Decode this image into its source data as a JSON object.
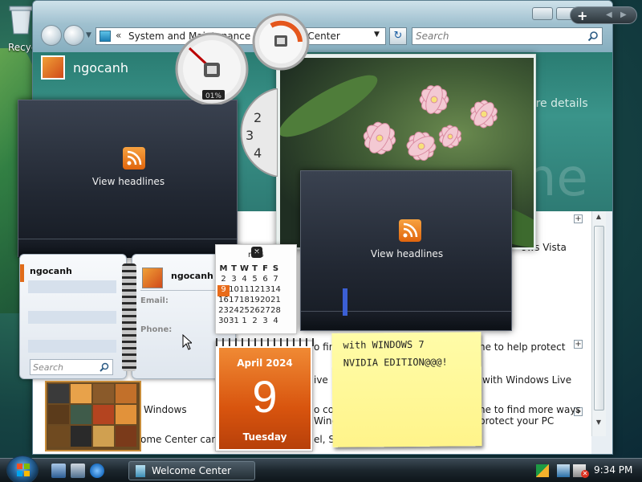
{
  "desktop": {
    "recycle_label": "Recycle"
  },
  "window": {
    "address": {
      "chevrons": "«",
      "path": "System and Maintenance › Welcome Center"
    },
    "search_placeholder": "Search",
    "user_name": "ngocanh",
    "more_details": "ore details",
    "big_text": "me",
    "content_lines": [
      "ows Vista",
      "ne to help protect",
      "with Windows Live",
      "ne to find more ways",
      "protect your PC",
      "Windows",
      "ome Center can b",
      "el, Sy",
      "o fin",
      "ive",
      "o co",
      "Wind"
    ]
  },
  "rss_gadget_1": {
    "label": "View headlines"
  },
  "rss_gadget_2": {
    "label": "View headlines"
  },
  "cpu_meter": {
    "cpu_percent": 1,
    "cpu_label": "01%"
  },
  "clock": {
    "numbers": [
      "2",
      "3",
      "4"
    ]
  },
  "contacts": {
    "list_name": "ngocanh",
    "search_placeholder": "Search",
    "detail_name": "ngocanh",
    "email_label": "Email:",
    "phone_label": "Phone:"
  },
  "calendar_month": {
    "title": "r 24",
    "days": [
      "M",
      "T",
      "W",
      "T",
      "F",
      "S"
    ],
    "rows": [
      [
        "2",
        "3",
        "4",
        "5",
        "6",
        "7"
      ],
      [
        "9",
        "10",
        "11",
        "12",
        "13",
        "14"
      ],
      [
        "16",
        "17",
        "18",
        "19",
        "20",
        "21"
      ],
      [
        "23",
        "24",
        "25",
        "26",
        "27",
        "28"
      ],
      [
        "30",
        "31",
        "1",
        "2",
        "3",
        "4"
      ]
    ],
    "today": "9"
  },
  "calendar_day": {
    "month_year": "April 2024",
    "day": "9",
    "weekday": "Tuesday"
  },
  "sticky_note": {
    "line1": "with WINDOWS 7",
    "line2": "NVIDIA EDITION@@@!"
  },
  "taskbar": {
    "task_label": "Welcome Center",
    "time": "9:34 PM"
  },
  "colors": {
    "accent_orange": "#e86b1a",
    "taskbar_dark": "#1c262d",
    "header_teal": "#2a7c72",
    "sticky_yellow": "#fff48a"
  }
}
